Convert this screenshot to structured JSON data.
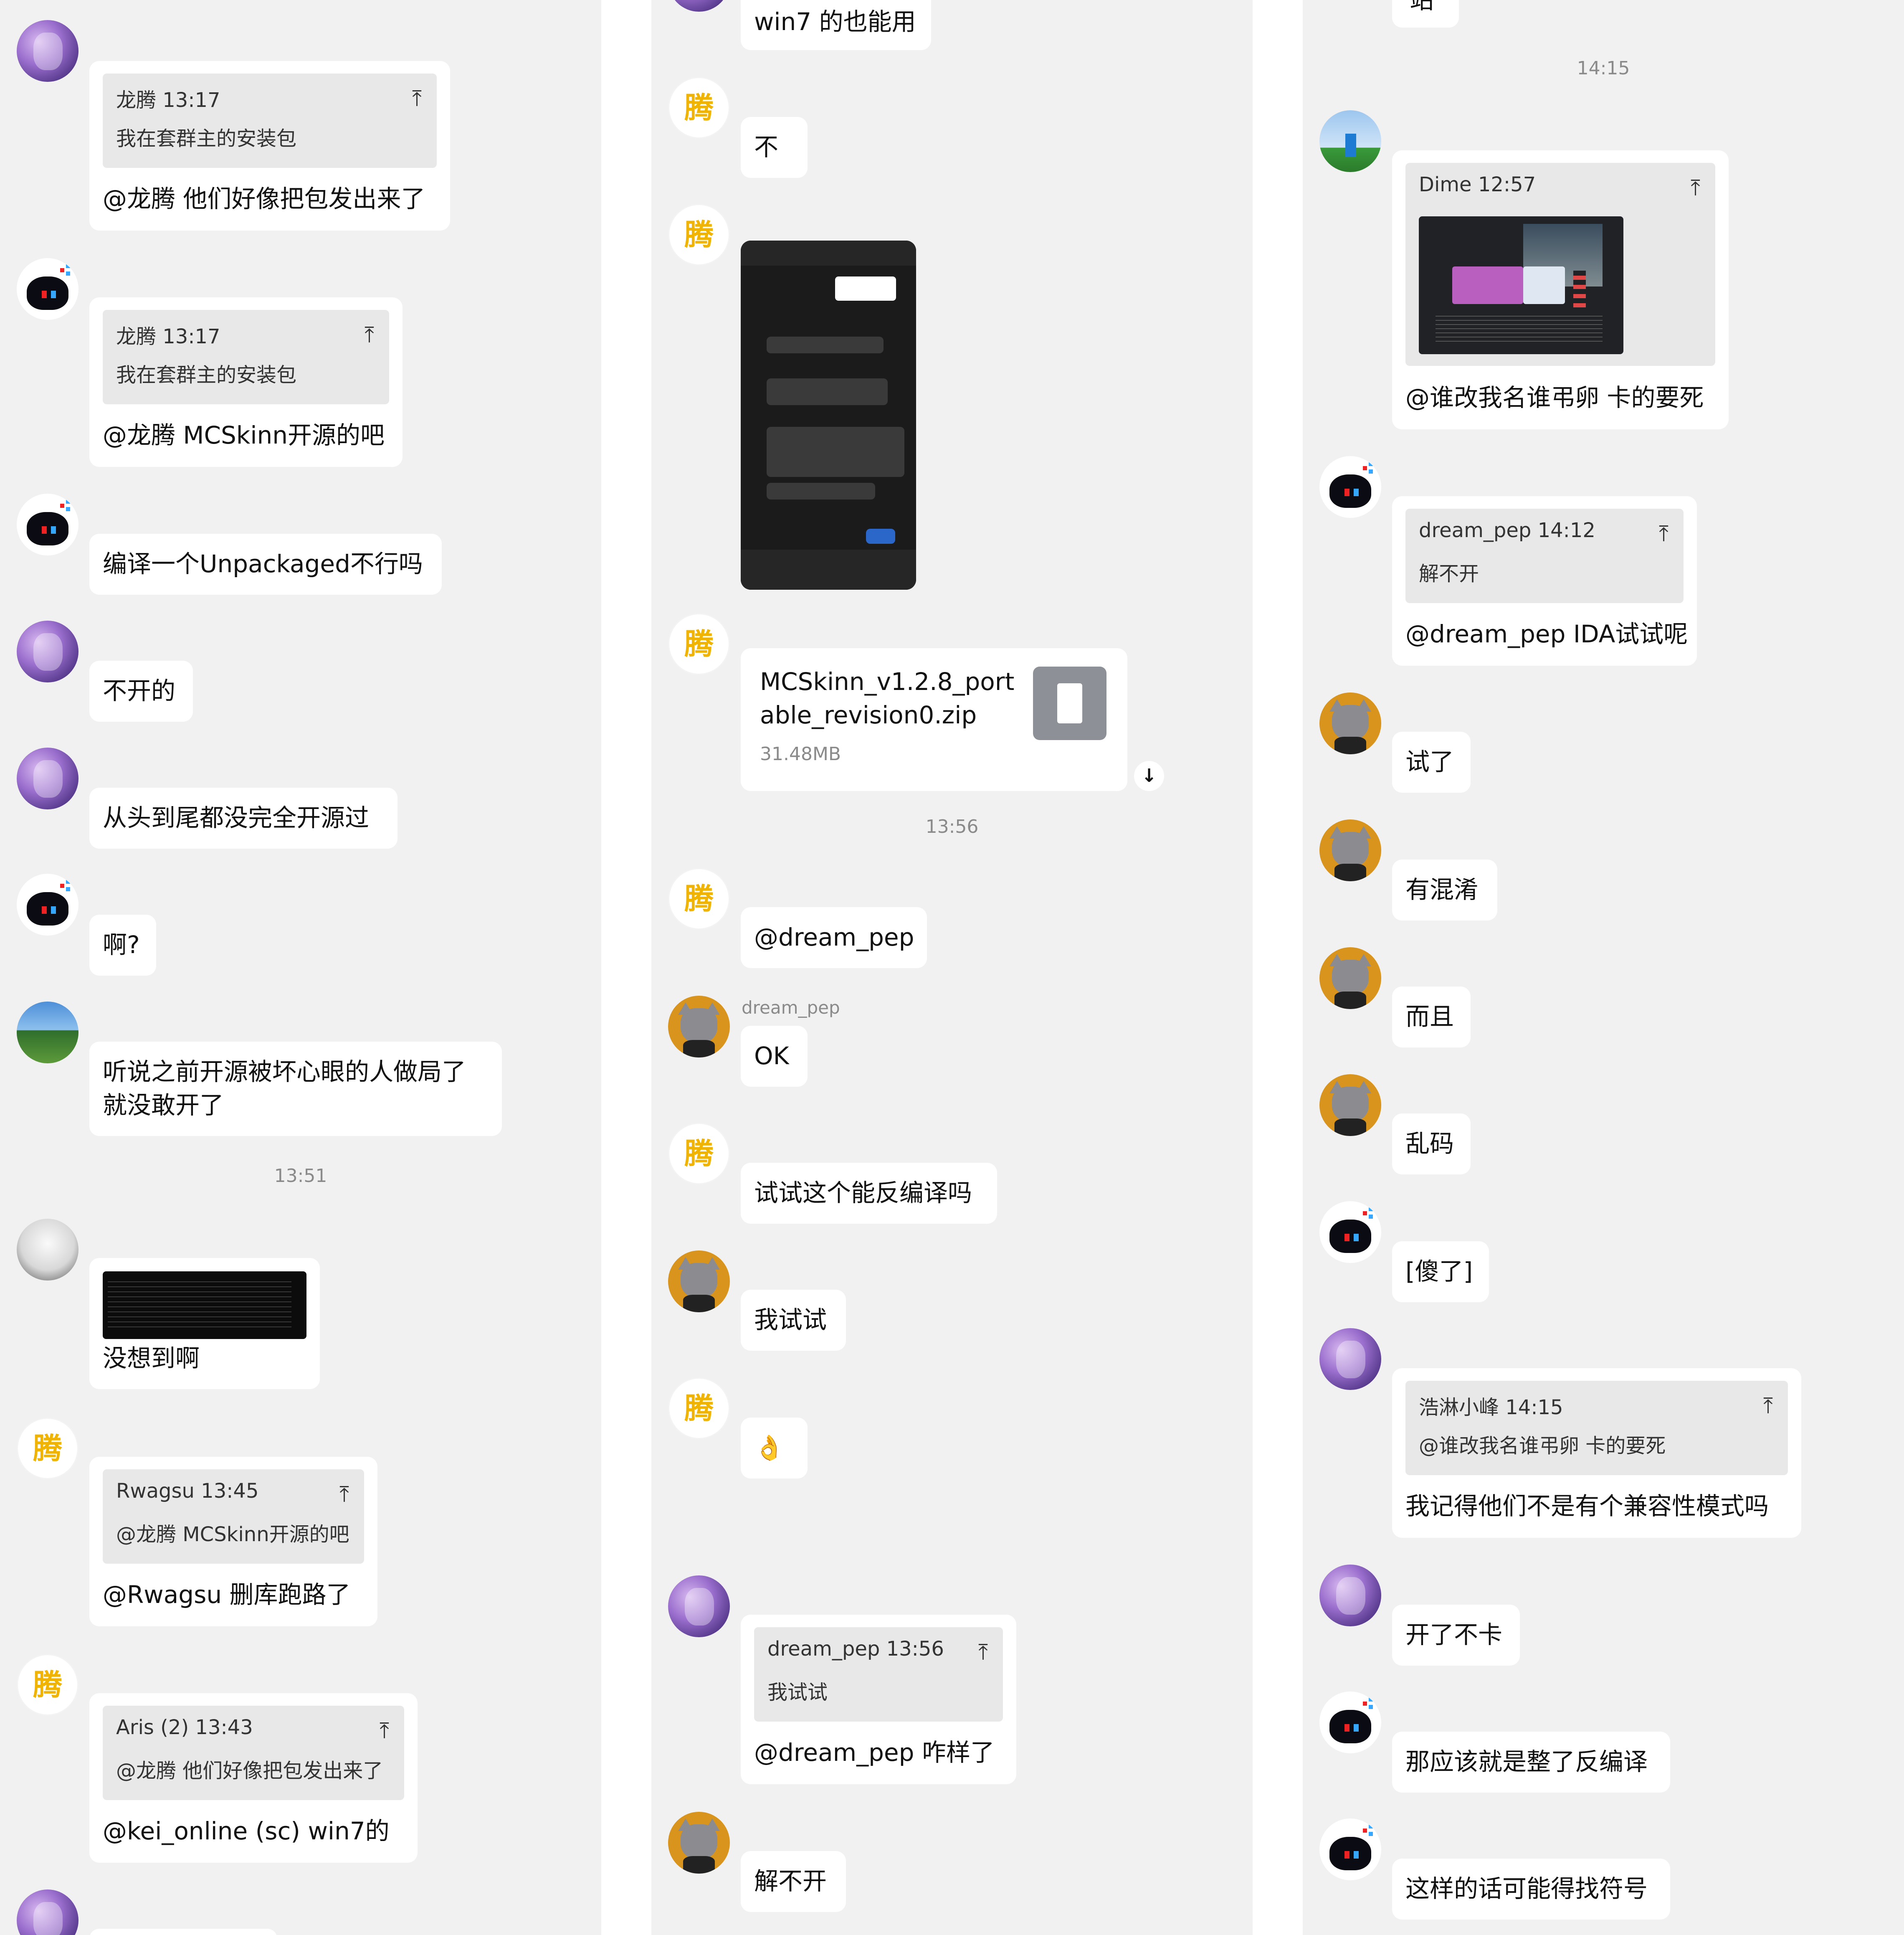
{
  "column1": {
    "q1": {
      "header": "龙腾 13:17",
      "quote": "我在套群主的安装包",
      "reply": "@龙腾 他们好像把包发出来了"
    },
    "q2": {
      "header": "龙腾 13:17",
      "quote": "我在套群主的安装包",
      "reply": "@龙腾 MCSkinn开源的吧"
    },
    "m1": "编译一个Unpackaged不行吗",
    "m2": "不开的",
    "m3": "从头到尾都没完全开源过",
    "m4": "啊?",
    "m5a": "听说之前开源被坏心眼的人做局了",
    "m5b": "就没敢开了",
    "time1": "13:51",
    "m6": "没想到啊",
    "q3": {
      "header": "Rwagsu 13:45",
      "quote": "@龙腾 MCSkinn开源的吧",
      "reply": "@Rwagsu 删库跑路了"
    },
    "q4": {
      "header": "Aris (2) 13:43",
      "quote": "@龙腾 他们好像把包发出来了",
      "reply": "@kei_online (sc) win7的"
    }
  },
  "column2": {
    "m1": "win7 的也能用",
    "m2": "不",
    "file": {
      "name_line1": "MCSkinn_v1.2.8_port",
      "name_line2": "able_revision0.zip",
      "size": "31.48MB"
    },
    "time1": "13:56",
    "m3": "@dream_pep",
    "sender": "dream_pep",
    "m4": "OK",
    "m5": "试试这个能反编译吗",
    "m6": "我试试",
    "m7": "👌",
    "q1": {
      "header": "dream_pep 13:56",
      "quote": "我试试",
      "reply": "@dream_pep 咋样了"
    },
    "m8": "解不开"
  },
  "column3": {
    "m0": "站",
    "time1": "14:15",
    "q1": {
      "header": "Dime 12:57",
      "reply": "@谁改我名谁弔卵 卡的要死"
    },
    "q2": {
      "header": "dream_pep 14:12",
      "quote": "解不开",
      "reply": "@dream_pep IDA试试呢"
    },
    "m1": "试了",
    "m2": "有混淆",
    "m3": "而且",
    "m4": "乱码",
    "m5": "[傻了]",
    "q3": {
      "header": "浩淋小峰 14:15",
      "quote": "@谁改我名谁弔卵 卡的要死",
      "reply": "我记得他们不是有个兼容性模式吗"
    },
    "m6": "开了不卡",
    "m7": "那应该就是整了反编译",
    "m8": "这样的话可能得找符号"
  },
  "icons": {
    "quote_jump": "⤒",
    "download": "↓"
  },
  "colors": {
    "background": "#f1f1f1",
    "bubble": "#ffffff",
    "quote": "#e8e8e8",
    "timestamp": "#8a8a8a"
  }
}
